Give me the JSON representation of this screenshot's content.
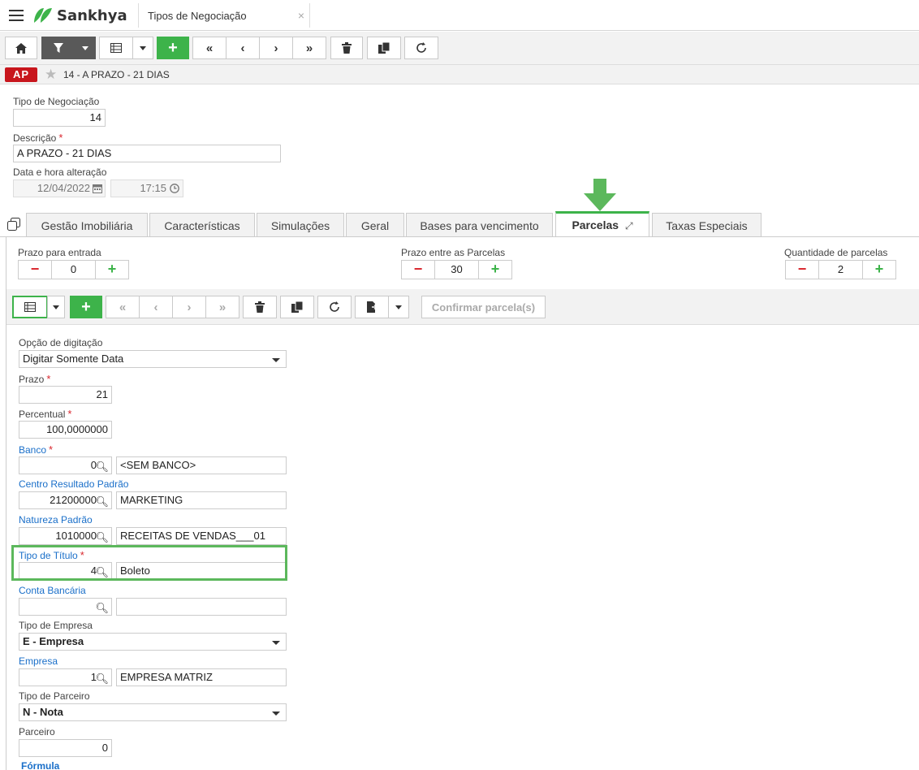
{
  "app": {
    "brand": "Sankhya",
    "tab_title": "Tipos de Negociação",
    "tab_close": "×"
  },
  "breadcrumb": {
    "badge": "AP",
    "record": "14 - A PRAZO - 21 DIAS"
  },
  "header_fields": {
    "tipo_label": "Tipo de Negociação",
    "tipo_value": "14",
    "descricao_label": "Descrição",
    "descricao_value": "A PRAZO - 21 DIAS",
    "data_label": "Data e hora alteração",
    "data_value": "12/04/2022",
    "hora_value": "17:15"
  },
  "tabs": [
    {
      "label": "Gestão Imobiliária"
    },
    {
      "label": "Características"
    },
    {
      "label": "Simulações"
    },
    {
      "label": "Geral"
    },
    {
      "label": "Bases para vencimento"
    },
    {
      "label": "Parcelas"
    },
    {
      "label": "Taxas Especiais"
    }
  ],
  "steppers": {
    "entrada_label": "Prazo para entrada",
    "entrada_value": "0",
    "entre_label": "Prazo entre as Parcelas",
    "entre_value": "30",
    "qtd_label": "Quantidade de parcelas",
    "qtd_value": "2"
  },
  "subtoolbar": {
    "confirm_label": "Confirmar parcela(s)"
  },
  "form": {
    "opcao_label": "Opção de digitação",
    "opcao_value": "Digitar Somente Data",
    "prazo_label": "Prazo",
    "prazo_value": "21",
    "percentual_label": "Percentual",
    "percentual_value": "100,0000000",
    "banco_label": "Banco",
    "banco_code": "0",
    "banco_name": "<SEM BANCO>",
    "cr_label": "Centro Resultado Padrão",
    "cr_code": "21200000",
    "cr_name": "MARKETING",
    "natureza_label": "Natureza Padrão",
    "natureza_code": "1010000",
    "natureza_name": "RECEITAS DE VENDAS___01",
    "titulo_label": "Tipo de Título",
    "titulo_code": "4",
    "titulo_name": "Boleto",
    "conta_label": "Conta Bancária",
    "conta_code": "",
    "conta_name": "",
    "tipo_empresa_label": "Tipo de Empresa",
    "tipo_empresa_value": "E - Empresa",
    "empresa_label": "Empresa",
    "empresa_code": "1",
    "empresa_name": "EMPRESA MATRIZ",
    "tipo_parceiro_label": "Tipo de Parceiro",
    "tipo_parceiro_value": "N - Nota",
    "parceiro_label": "Parceiro",
    "parceiro_value": "0",
    "formula_label": "Fórmula"
  },
  "colors": {
    "accent_green": "#3db34a",
    "badge_red": "#c8161d",
    "link_blue": "#1a6fc9",
    "highlight_green": "#5cb85c"
  }
}
